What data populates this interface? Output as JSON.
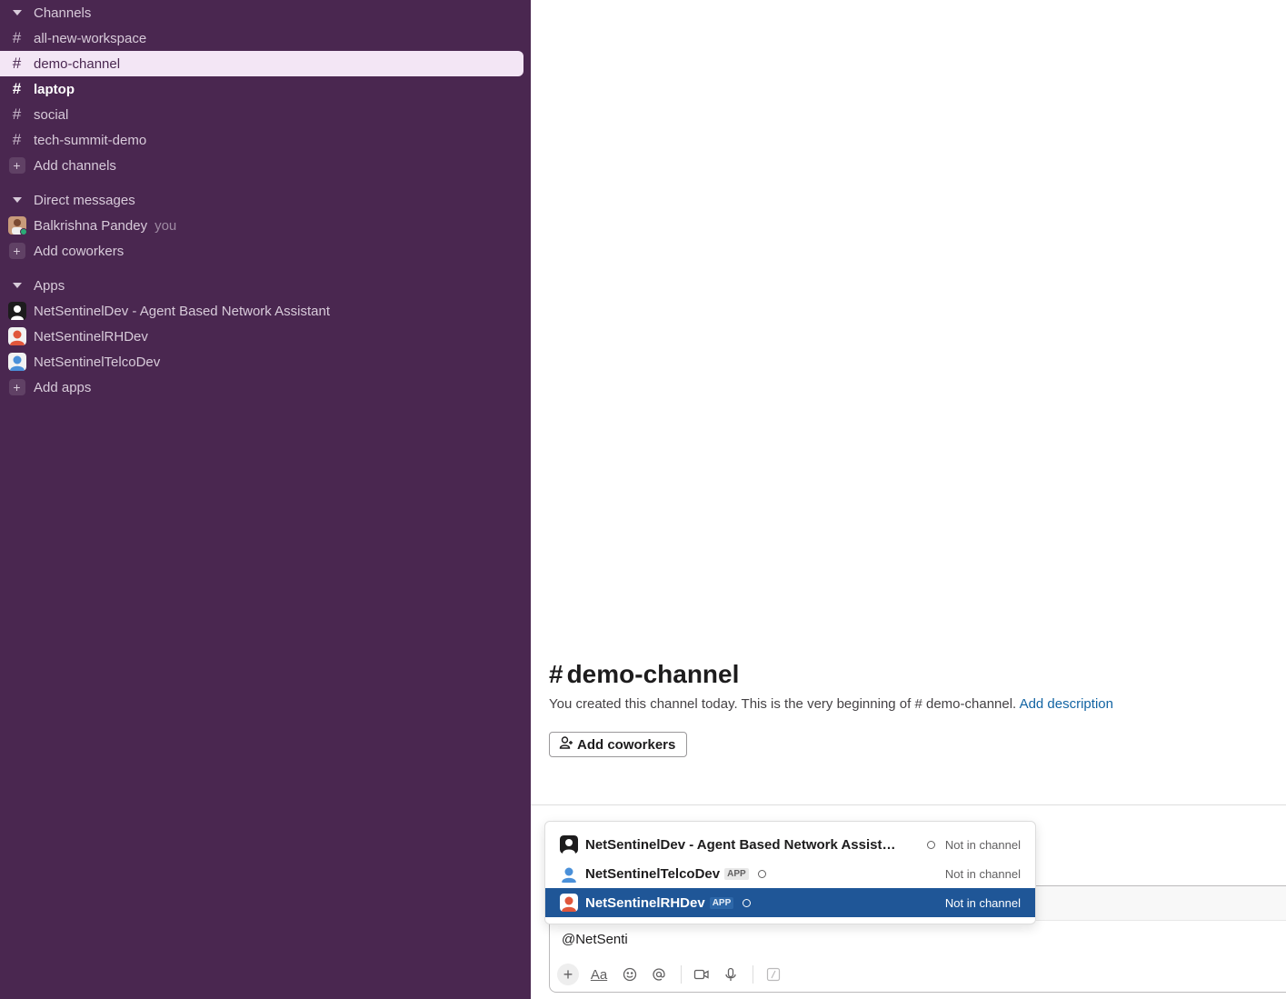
{
  "sidebar": {
    "channels_header": "Channels",
    "channels": [
      {
        "label": "all-new-workspace"
      },
      {
        "label": "demo-channel"
      },
      {
        "label": "laptop"
      },
      {
        "label": "social"
      },
      {
        "label": "tech-summit-demo"
      }
    ],
    "add_channels": "Add channels",
    "dm_header": "Direct messages",
    "dm_user": "Balkrishna Pandey",
    "dm_you": "you",
    "add_coworkers": "Add coworkers",
    "apps_header": "Apps",
    "apps": [
      {
        "label": "NetSentinelDev - Agent Based Network Assistant"
      },
      {
        "label": "NetSentinelRHDev"
      },
      {
        "label": "NetSentinelTelcoDev"
      }
    ],
    "add_apps": "Add apps"
  },
  "main": {
    "hash": "#",
    "channel_name": "demo-channel",
    "intro_text": "You created this channel today. This is the very beginning of # demo-channel.",
    "add_description": "Add description",
    "add_coworkers_button": "Add coworkers"
  },
  "composer": {
    "value": "@NetSenti",
    "format_label": "Aa"
  },
  "autocomplete": {
    "items": [
      {
        "name": "NetSentinelDev - Agent Based Network Assistant...",
        "badge": "",
        "status": "Not in channel"
      },
      {
        "name": "NetSentinelTelcoDev",
        "badge": "APP",
        "status": "Not in channel"
      },
      {
        "name": "NetSentinelRHDev",
        "badge": "APP",
        "status": "Not in channel"
      }
    ]
  },
  "colors": {
    "sidebar_bg": "#4a2750",
    "active_row_bg": "#f3e6f5",
    "selection_bg": "#1f5697",
    "link": "#1264a3"
  }
}
